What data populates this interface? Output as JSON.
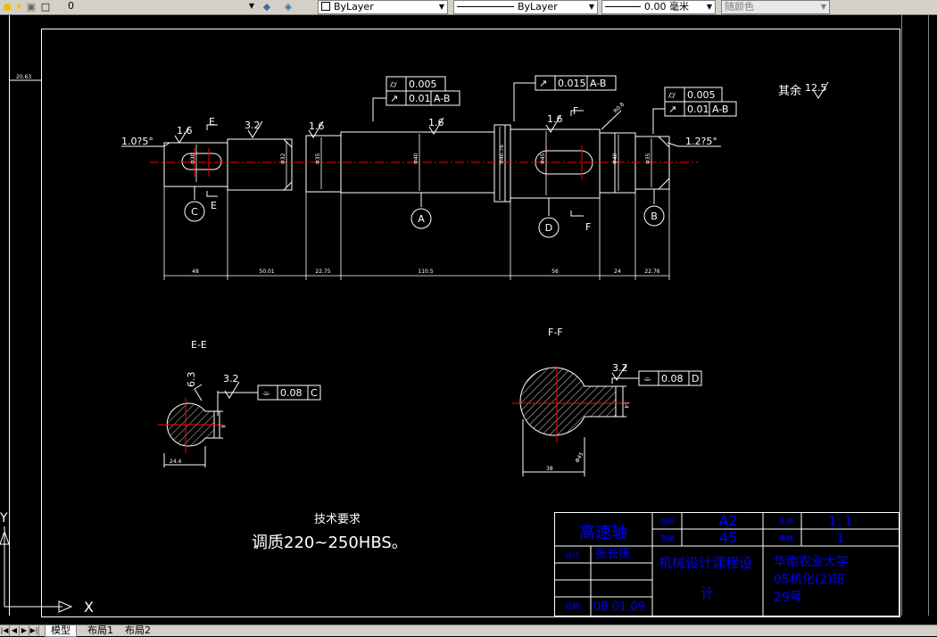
{
  "toolbar": {
    "layer_value": "0",
    "color_value": "ByLayer",
    "linetype_value": "ByLayer",
    "lineweight_value": "0.00 毫米",
    "plotstyle_value": "随颜色"
  },
  "tabs": {
    "model": "模型",
    "layout1": "布局1",
    "layout2": "布局2"
  },
  "drawing": {
    "ruler_dim": "20.63",
    "roughness_rest_label": "其余",
    "roughness_rest_value": "12.5",
    "gdt": {
      "left_runout_value": "0.005",
      "left_total_value": "0.01",
      "left_total_ref": "A-B",
      "mid_runout_value": "0.015",
      "mid_runout_ref": "A-B",
      "right_runout_value": "0.005",
      "right_total_value": "0.01",
      "right_total_ref": "A-B",
      "ee_sym_value": "0.08",
      "ee_sym_ref": "C",
      "ff_sym_value": "0.08",
      "ff_sym_ref": "D"
    },
    "roughness_marks": [
      "1.6",
      "3.2",
      "1.6",
      "1.6",
      "1.6",
      "3.2",
      "3.2",
      "6.3"
    ],
    "chamfer_left": "1.0?5°",
    "chamfer_right": "1.2?5°",
    "section_labels": {
      "e_top": "E",
      "e_bot": "E",
      "f_top": "F",
      "f_bot": "F"
    },
    "datums": {
      "a": "A",
      "b": "B",
      "c": "C",
      "d": "D"
    },
    "dia_labels": [
      "Φ30",
      "Φ32",
      "Φ35",
      "Φ40",
      "Φ40.76",
      "Φ45",
      "Φ40",
      "Φ35"
    ],
    "keyway_note": "R0.8",
    "dimensions": [
      "48",
      "50.01",
      "22.75",
      "110.5",
      "56",
      "24",
      "22.76"
    ],
    "section_ee_title": "E-E",
    "section_ff_title": "F-F",
    "ee_dims": {
      "width": "24.4",
      "depth": "8"
    },
    "ff_dims": {
      "width": "38",
      "depth": "14",
      "dia": "Φ45"
    },
    "tech_req_title": "技术要求",
    "tech_req_text": "调质220~250HBS。"
  },
  "title_block": {
    "part_name": "高速轴",
    "label_material_code": "材料",
    "sheet_size": "A2",
    "label_scale": "比例",
    "scale_value": "1: 1",
    "label_qty": "数量",
    "material_value": "45",
    "label_count": "件数",
    "count_value": "1",
    "label_designer": "设计",
    "designer_name": "张长烁",
    "course_title_1": "机械设计课程设",
    "course_title_2": "计",
    "school_1": "华南农业大学",
    "school_2": "05机化(2)班",
    "school_3": "29号",
    "label_date": "日期",
    "date_value": "08.01.09"
  },
  "ucs": {
    "x_label": "X",
    "y_label": "Y"
  },
  "colors": {
    "background": "#000000",
    "lines": "#ffffff",
    "centerline": "#ff0000",
    "title_text": "#0000ff",
    "toolbar": "#d4d0c8"
  }
}
